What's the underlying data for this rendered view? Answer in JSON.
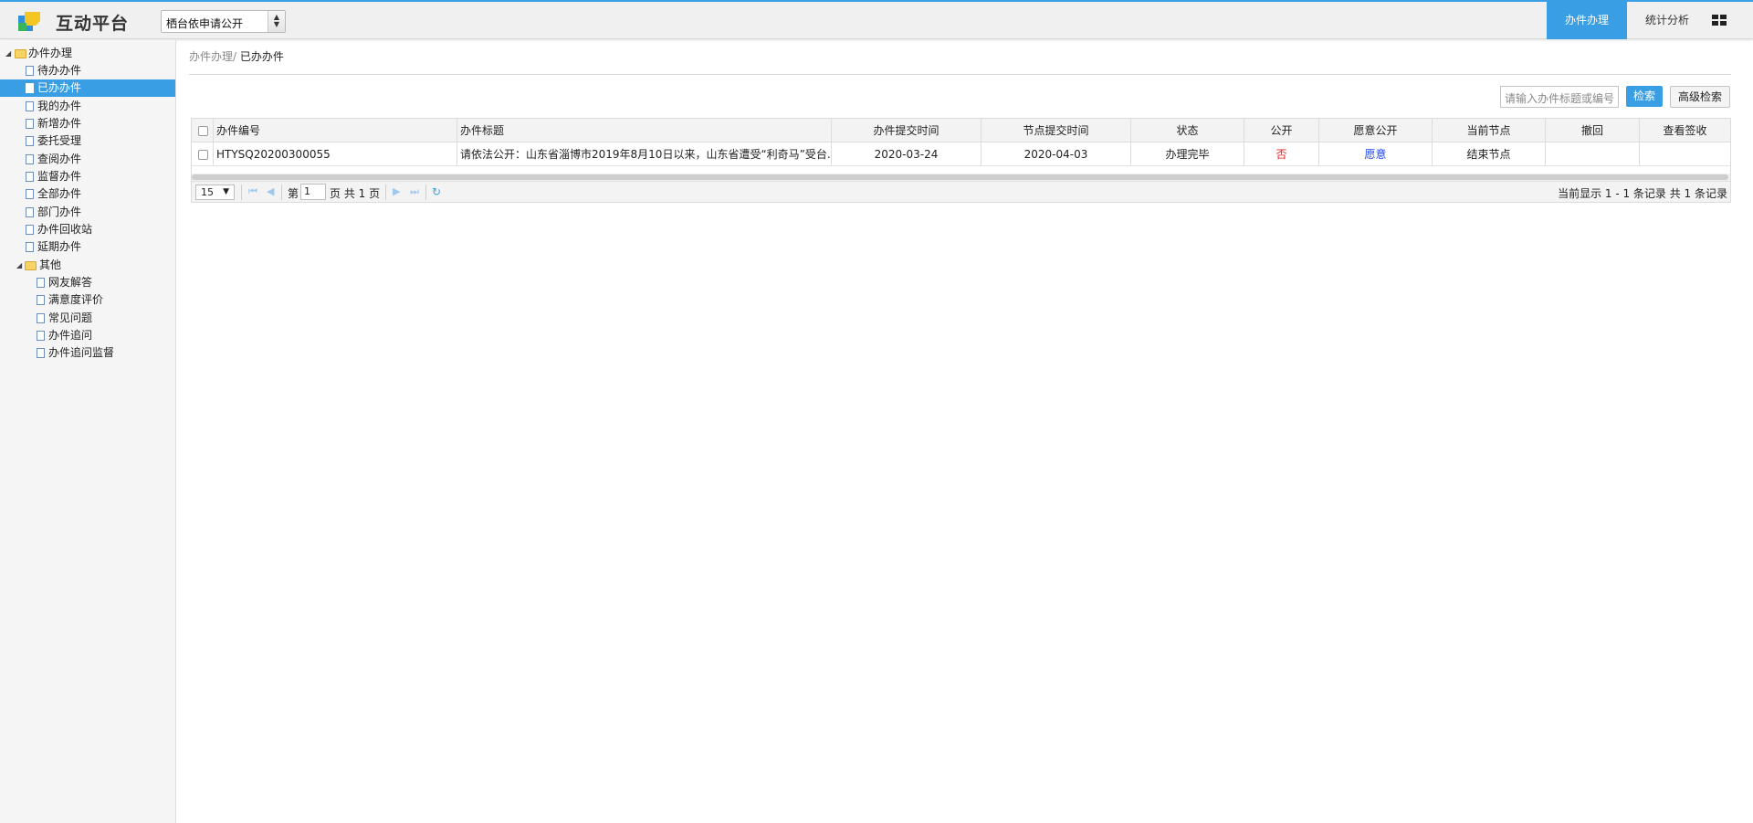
{
  "app": {
    "title": "互动平台"
  },
  "header": {
    "select_value": "栖台依申请公开",
    "tabs": [
      {
        "label": "办件办理",
        "active": true
      },
      {
        "label": "统计分析",
        "active": false
      }
    ]
  },
  "sidebar": {
    "root": "办件办理",
    "items": [
      "待办办件",
      "已办办件",
      "我的办件",
      "新增办件",
      "委托受理",
      "查阅办件",
      "监督办件",
      "全部办件",
      "部门办件",
      "办件回收站",
      "延期办件"
    ],
    "other_group": "其他",
    "other_items": [
      "网友解答",
      "满意度评价",
      "常见问题",
      "办件追问",
      "办件追问监督"
    ],
    "selected": "已办办件"
  },
  "breadcrumb": {
    "parent": "办件办理/",
    "current": "已办办件"
  },
  "search": {
    "placeholder": "请输入办件标题或编号",
    "search_label": "检索",
    "advanced_label": "高级检索"
  },
  "table": {
    "columns": [
      "办件编号",
      "办件标题",
      "办件提交时间",
      "节点提交时间",
      "状态",
      "公开",
      "愿意公开",
      "当前节点",
      "撤回",
      "查看签收"
    ],
    "rows": [
      {
        "id": "HTYSQ20200300055",
        "title": "请依法公开：山东省淄博市2019年8月10日以来，山东省遭受“利奇马”受台...",
        "submit_time": "2020-03-24",
        "node_time": "2020-04-03",
        "status": "办理完毕",
        "public": "否",
        "willing_public": "愿意",
        "node": "结束节点",
        "withdraw": "",
        "view_sign": ""
      }
    ]
  },
  "pager": {
    "page_size": "15",
    "page_prefix": "第",
    "page_value": "1",
    "page_suffix": "页 共 1 页",
    "info": "当前显示 1 - 1 条记录 共 1 条记录"
  },
  "colors": {
    "accent": "#3a9ee4",
    "negative": "#e02020",
    "link": "#2244ee"
  }
}
